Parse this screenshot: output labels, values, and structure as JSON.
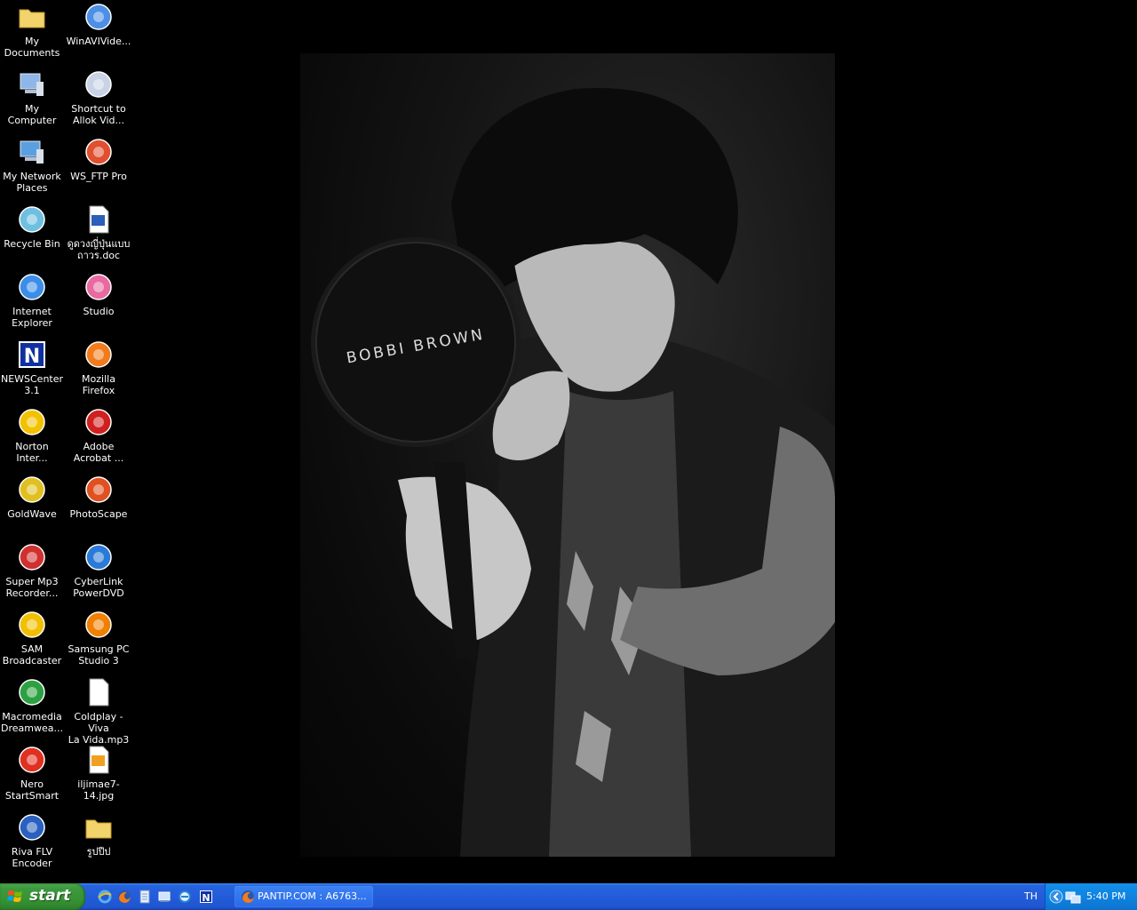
{
  "desktop_icons": [
    {
      "label": "My Documents",
      "icon": "my-documents-icon"
    },
    {
      "label": "WinAVIVide...",
      "icon": "winavi-icon"
    },
    {
      "label": "My Computer",
      "icon": "my-computer-icon"
    },
    {
      "label": "Shortcut to\nAllok Vid...",
      "icon": "allok-video-icon"
    },
    {
      "label": "My Network\nPlaces",
      "icon": "network-places-icon"
    },
    {
      "label": "WS_FTP Pro",
      "icon": "ws-ftp-icon"
    },
    {
      "label": "Recycle Bin",
      "icon": "recycle-bin-icon"
    },
    {
      "label": "ดูดวงญี่ปุ่นแบบ\nถาวร.doc",
      "icon": "word-document-icon"
    },
    {
      "label": "Internet\nExplorer",
      "icon": "internet-explorer-icon"
    },
    {
      "label": "Studio",
      "icon": "studio-icon"
    },
    {
      "label": "NEWSCenter\n3.1",
      "icon": "newscenter-icon"
    },
    {
      "label": "Mozilla Firefox",
      "icon": "firefox-icon"
    },
    {
      "label": "Norton\nInter...",
      "icon": "norton-icon"
    },
    {
      "label": "Adobe\nAcrobat ...",
      "icon": "adobe-acrobat-icon"
    },
    {
      "label": "GoldWave",
      "icon": "goldwave-icon"
    },
    {
      "label": "PhotoScape",
      "icon": "photoscape-icon"
    },
    {
      "label": "Super Mp3\nRecorder...",
      "icon": "super-mp3-icon"
    },
    {
      "label": "CyberLink\nPowerDVD",
      "icon": "powerdvd-icon"
    },
    {
      "label": "SAM\nBroadcaster",
      "icon": "sam-broadcaster-icon"
    },
    {
      "label": "Samsung PC\nStudio 3",
      "icon": "samsung-pc-studio-icon"
    },
    {
      "label": "Macromedia\nDreamwea...",
      "icon": "dreamweaver-icon"
    },
    {
      "label": "Coldplay - Viva\nLa Vida.mp3",
      "icon": "mp3-file-icon"
    },
    {
      "label": "Nero\nStartSmart",
      "icon": "nero-icon"
    },
    {
      "label": "iljimae7-14.jpg",
      "icon": "jpg-file-icon"
    },
    {
      "label": "Riva FLV\nEncoder",
      "icon": "riva-flv-icon"
    },
    {
      "label": "รูปปีป",
      "icon": "folder-icon"
    }
  ],
  "wallpaper": {
    "mirror_text": "BOBBI BROWN"
  },
  "taskbar": {
    "start_label": "start",
    "quick_launch": [
      "internet-explorer-icon",
      "firefox-icon",
      "notepad-icon",
      "desktop-icon",
      "ie-icon",
      "newscenter-icon"
    ],
    "task_button_label": "PANTIP.COM : A6763...",
    "language": "TH",
    "clock": "5:40 PM"
  },
  "colors": {
    "taskbar_blue": "#245edb",
    "start_green": "#379334",
    "tray_blue": "#0f83e0",
    "desktop": "#000000"
  }
}
